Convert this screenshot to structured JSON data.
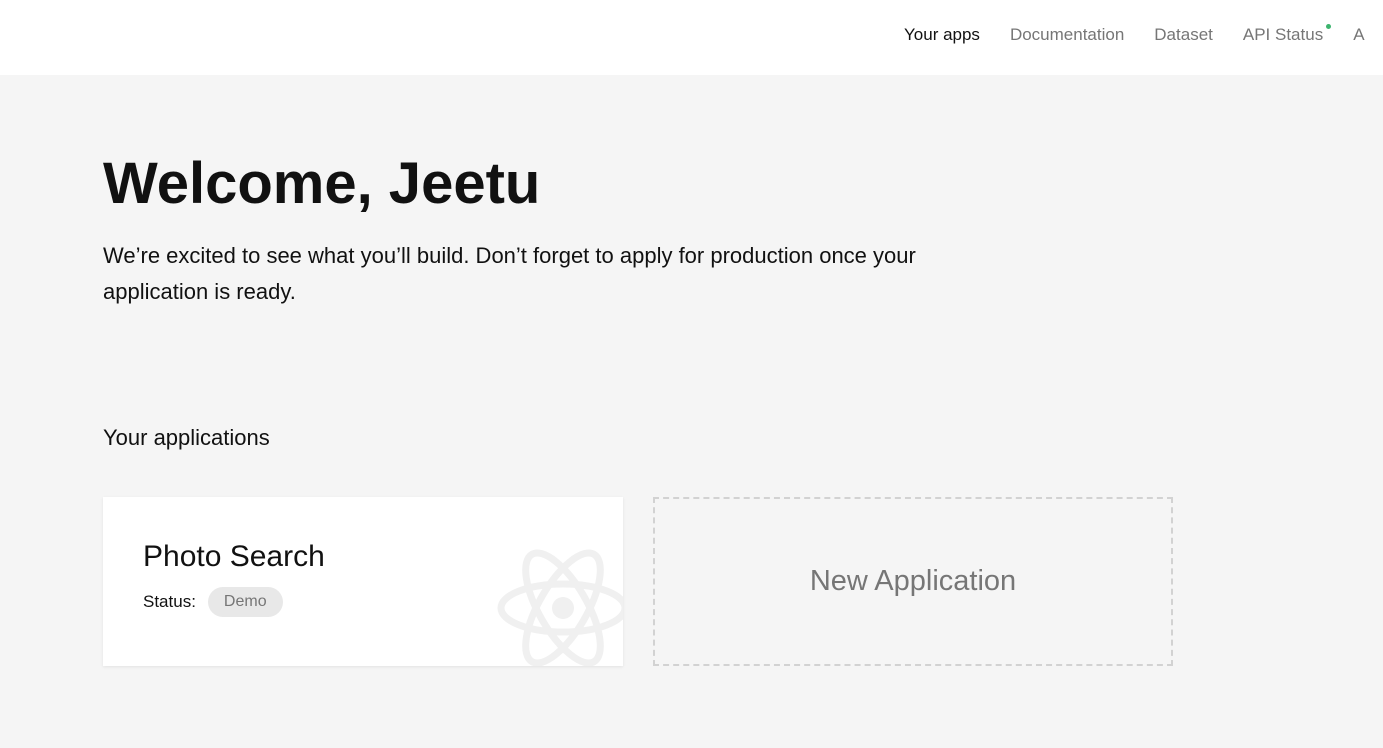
{
  "nav": {
    "items": [
      {
        "label": "Your apps",
        "active": true
      },
      {
        "label": "Documentation"
      },
      {
        "label": "Dataset"
      },
      {
        "label": "API Status",
        "status_dot_color": "#3cb46e"
      },
      {
        "label": "A"
      }
    ]
  },
  "welcome": {
    "title": "Welcome, Jeetu",
    "intro": "We’re excited to see what you’ll build. Don’t forget to apply for production once your application is ready."
  },
  "applications": {
    "section_title": "Your applications",
    "apps": [
      {
        "name": "Photo Search",
        "status_label": "Status:",
        "status": "Demo",
        "icon": "atom-icon"
      }
    ],
    "new_label": "New Application"
  }
}
